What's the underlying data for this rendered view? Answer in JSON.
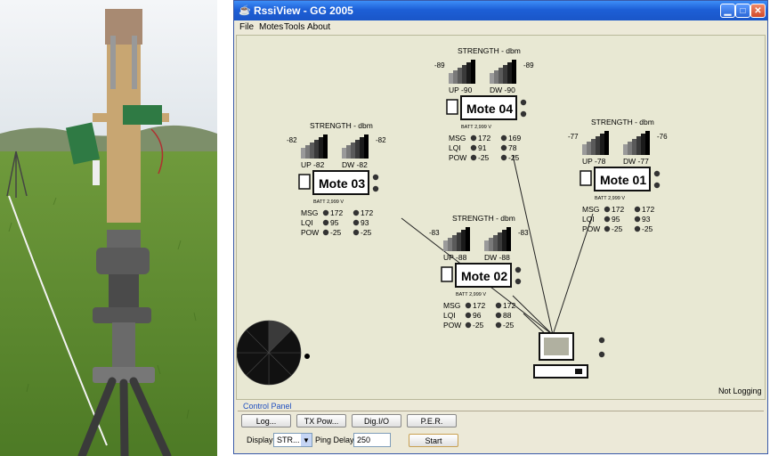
{
  "window": {
    "title": "RssiView  -  GG 2005"
  },
  "menu": [
    "File",
    "Motes",
    "Tools",
    "About"
  ],
  "status": {
    "logging": "Not Logging"
  },
  "control_panel": {
    "title": "Control Panel",
    "buttons": [
      "Log...",
      "TX Pow...",
      "Dig.I/O",
      "P.E.R."
    ],
    "display_label": "Display:",
    "display_value": "STR...",
    "ping_delay_label": "Ping Delay:",
    "ping_delay_value": "250",
    "start_label": "Start"
  },
  "strength_title": "STRENGTH - dbm",
  "labels": {
    "msg": "MSG",
    "lqi": "LQI",
    "pow": "POW",
    "batt": "BATT 2,999 V"
  },
  "motes": [
    {
      "name": "Mote 04",
      "up_label": "UP -90",
      "dw_label": "DW -90",
      "left_val": "-89",
      "right_val": "-89",
      "msg": [
        "172",
        "169"
      ],
      "lqi": [
        "91",
        "78"
      ],
      "pow": [
        "-25",
        "-25"
      ]
    },
    {
      "name": "Mote 03",
      "up_label": "UP -82",
      "dw_label": "DW -82",
      "left_val": "-82",
      "right_val": "-82",
      "msg": [
        "172",
        "172"
      ],
      "lqi": [
        "95",
        "93"
      ],
      "pow": [
        "-25",
        "-25"
      ]
    },
    {
      "name": "Mote 01",
      "up_label": "UP -78",
      "dw_label": "DW -77",
      "left_val": "-77",
      "right_val": "-76",
      "msg": [
        "172",
        "172"
      ],
      "lqi": [
        "95",
        "93"
      ],
      "pow": [
        "-25",
        "-25"
      ]
    },
    {
      "name": "Mote 02",
      "up_label": "UP -88",
      "dw_label": "DW -88",
      "left_val": "-83",
      "right_val": "-83",
      "msg": [
        "172",
        "172"
      ],
      "lqi": [
        "96",
        "88"
      ],
      "pow": [
        "-25",
        "-25"
      ]
    }
  ]
}
